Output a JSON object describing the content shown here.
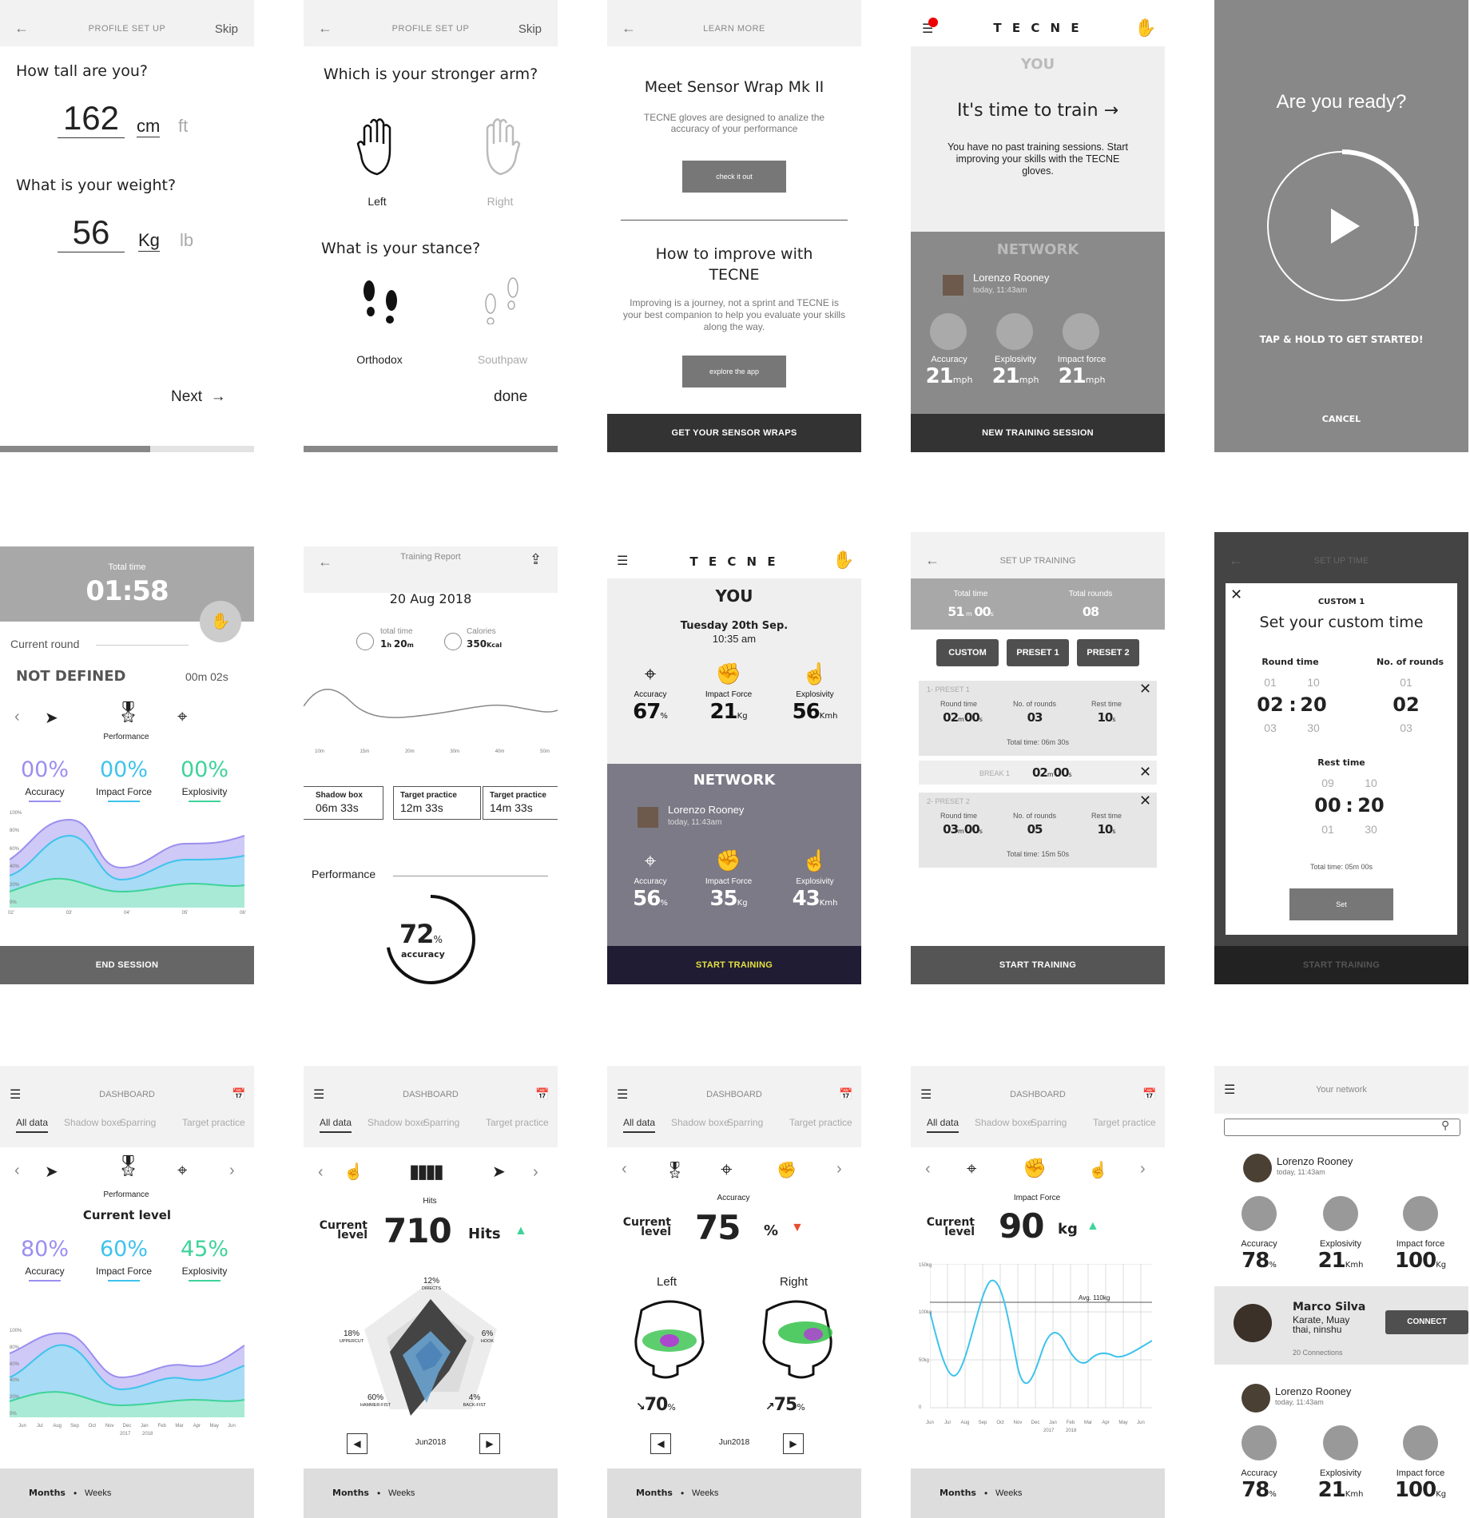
{
  "s1": {
    "header": "PROFILE SET UP",
    "skip": "Skip",
    "q1": "How tall are you?",
    "height": "162",
    "unit_cm": "cm",
    "unit_ft": "ft",
    "q2": "What is your weight?",
    "weight": "56",
    "unit_kg": "Kg",
    "unit_lb": "lb",
    "next": "Next",
    "progress": 0.59
  },
  "s2": {
    "header": "PROFILE SET UP",
    "skip": "Skip",
    "q1": "Which is your stronger arm?",
    "left": "Left",
    "right": "Right",
    "q2": "What is your stance?",
    "orthodox": "Orthodox",
    "southpaw": "Southpaw",
    "done": "done"
  },
  "s3": {
    "header": "LEARN MORE",
    "title1": "Meet Sensor Wrap Mk II",
    "text1": "TECNE gloves are designed to analize the accuracy of your performance",
    "btn1": "check it out",
    "title2": "How to improve with TECNE",
    "text2": "Improving is a journey, not a sprint and TECNE is your best companion to help you evaluate your skills along the way.",
    "btn2": "explore the app",
    "footer": "GET YOUR SENSOR WRAPS"
  },
  "s4": {
    "logo": "T E C N E",
    "you": "YOU",
    "cta": "It's time to train",
    "text": "You have no past training sessions. Start improving your skills with the TECNE gloves.",
    "network": "NETWORK",
    "user": "Lorenzo Rooney",
    "time": "today, 11:43am",
    "stats": [
      {
        "label": "Accuracy",
        "value": "21",
        "unit": "mph"
      },
      {
        "label": "Explosivity",
        "value": "21",
        "unit": "mph"
      },
      {
        "label": "Impact force",
        "value": "21",
        "unit": "mph"
      }
    ],
    "footer": "NEW TRAINING SESSION"
  },
  "s5": {
    "title": "Are you ready?",
    "hint": "TAP & HOLD TO  GET STARTED!",
    "cancel": "CANCEL"
  },
  "s6": {
    "total_label": "Total time",
    "total": "01:58",
    "round_label": "Current round",
    "state": "NOT DEFINED",
    "round_time": "00m 02s",
    "perf": "Performance",
    "stats": [
      {
        "label": "Accuracy",
        "value": "00%",
        "color": "#9b8ef0"
      },
      {
        "label": "Impact Force",
        "value": "00%",
        "color": "#3ec3ec"
      },
      {
        "label": "Explosivity",
        "value": "00%",
        "color": "#3ed39a"
      }
    ],
    "y_ticks": [
      "100%",
      "80%",
      "60%",
      "40%",
      "20%",
      "0%"
    ],
    "x_ticks": [
      "02'",
      "03'",
      "04'",
      "05'",
      "06'"
    ],
    "footer": "END SESSION"
  },
  "s7": {
    "header": "Training Report",
    "date": "20 Aug 2018",
    "tt_label": "total time",
    "tt_h": "1",
    "tt_m": "20",
    "cal_label": "Calories",
    "cal": "350",
    "cal_unit": "Kcal",
    "x_ticks": [
      "10m",
      "15m",
      "20m",
      "30m",
      "40m",
      "50m"
    ],
    "cards": [
      {
        "title": "Shadow box",
        "value": "06m 33s"
      },
      {
        "title": "Target practice",
        "value": "12m 33s"
      },
      {
        "title": "Target practice",
        "value": "14m 33s"
      }
    ],
    "perf": "Performance",
    "pct": "72",
    "pct_label": "accuracy"
  },
  "s8": {
    "logo": "T E C N E",
    "you": "YOU",
    "date": "Tuesday 20th Sep.",
    "time": "10:35 am",
    "you_stats": [
      {
        "label": "Accuracy",
        "value": "67",
        "unit": "%"
      },
      {
        "label": "Impact Force",
        "value": "21",
        "unit": "Kg"
      },
      {
        "label": "Explosivity",
        "value": "56",
        "unit": "Kmh"
      }
    ],
    "network": "NETWORK",
    "user": "Lorenzo Rooney",
    "utime": "today, 11:43am",
    "net_stats": [
      {
        "label": "Accuracy",
        "value": "56",
        "unit": "%"
      },
      {
        "label": "Impact Force",
        "value": "35",
        "unit": "Kg"
      },
      {
        "label": "Explosivity",
        "value": "43",
        "unit": "Kmh"
      }
    ],
    "footer": "START TRAINING"
  },
  "s9": {
    "header": "SET UP TRAINING",
    "tt_label": "Total time",
    "tt_m": "51",
    "tt_s": "00",
    "tr_label": "Total rounds",
    "tr": "08",
    "presets": [
      "CUSTOM",
      "PRESET 1",
      "PRESET 2"
    ],
    "p1": {
      "tag": "1- PRESET 1",
      "rt_label": "Round time",
      "rt_m": "02",
      "rt_s": "00",
      "nr_label": "No. of rounds",
      "nr": "03",
      "rest_label": "Rest time",
      "rest": "10",
      "total": "Total time: 06m 30s"
    },
    "brk": {
      "tag": "BREAK 1",
      "m": "02",
      "s": "00"
    },
    "p2": {
      "tag": "2- PRESET 2",
      "rt_label": "Round time",
      "rt_m": "03",
      "rt_s": "00",
      "nr_label": "No. of rounds",
      "nr": "05",
      "rest_label": "Rest time",
      "rest": "10",
      "total": "Total time: 15m 50s"
    },
    "footer": "START TRAINING"
  },
  "s10": {
    "header": "SET UP TIME",
    "tag": "CUSTOM 1",
    "title": "Set your custom time",
    "rt_label": "Round time",
    "nr_label": "No. of rounds",
    "rt_prev": [
      "01",
      "10"
    ],
    "rt": [
      "02",
      "20"
    ],
    "rt_next": [
      "03",
      "30"
    ],
    "nr_prev": "01",
    "nr": "02",
    "nr_next": "03",
    "rest_label": "Rest time",
    "rest_prev": [
      "09",
      "10"
    ],
    "rest": [
      "00",
      "20"
    ],
    "rest_next": [
      "01",
      "30"
    ],
    "total": "Total time: 05m 00s",
    "set": "Set",
    "footer": "START TRAINING"
  },
  "dash_tabs": [
    "All data",
    "Shadow boxe",
    "Sparring",
    "Target practice"
  ],
  "s11": {
    "header": "DASHBOARD",
    "perf": "Performance",
    "level": "Current level",
    "stats": [
      {
        "label": "Accuracy",
        "value": "80%",
        "color": "#9b8ef0"
      },
      {
        "label": "Impact Force",
        "value": "60%",
        "color": "#3ec3ec"
      },
      {
        "label": "Explosivity",
        "value": "45%",
        "color": "#3ed39a"
      }
    ],
    "y_ticks": [
      "100%",
      "80%",
      "60%",
      "40%",
      "20%",
      "0%"
    ],
    "x_ticks": [
      "Jun",
      "Jul",
      "Aug",
      "Sep",
      "Oct",
      "Nov",
      "Dec",
      "Jan",
      "Feb",
      "Mar",
      "Apr",
      "May",
      "Jun"
    ],
    "years": [
      "2017",
      "2018"
    ],
    "months": "Months",
    "weeks": "Weeks"
  },
  "s12": {
    "header": "DASHBOARD",
    "icon_label": "Hits",
    "level1": "Current",
    "level2": "level",
    "value": "710",
    "unit": "Hits",
    "radar": [
      {
        "pct": "12%",
        "label": "DIRECTS"
      },
      {
        "pct": "6%",
        "label": "HOOK"
      },
      {
        "pct": "4%",
        "label": "BACK-FIST"
      },
      {
        "pct": "60%",
        "label": "HAMMER-FIST"
      },
      {
        "pct": "18%",
        "label": "UPPERCUT"
      }
    ],
    "period": "Jun2018",
    "months": "Months",
    "weeks": "Weeks"
  },
  "s13": {
    "header": "DASHBOARD",
    "icon_label": "Accuracy",
    "level1": "Current",
    "level2": "level",
    "value": "75",
    "unit": "%",
    "left": "Left",
    "right": "Right",
    "left_val": "70",
    "right_val": "75",
    "period": "Jun2018",
    "months": "Months",
    "weeks": "Weeks"
  },
  "s14": {
    "header": "DASHBOARD",
    "icon_label": "Impact Force",
    "level1": "Current",
    "level2": "level",
    "value": "90",
    "unit": "kg",
    "avg": "Avg. 110kg",
    "y_ticks": [
      "150kg",
      "100kg",
      "50kg",
      "0"
    ],
    "x_ticks": [
      "Jun",
      "Jul",
      "Aug",
      "Sep",
      "Oct",
      "Nov",
      "Dec",
      "Jan",
      "Feb",
      "Mar",
      "Apr",
      "May",
      "Jun"
    ],
    "years": [
      "2017",
      "2018"
    ],
    "months": "Months",
    "weeks": "Weeks"
  },
  "s15": {
    "header": "Your network",
    "search_placeholder": "",
    "p1": {
      "name": "Lorenzo Rooney",
      "time": "today, 11:43am"
    },
    "stats": [
      {
        "label": "Accuracy",
        "value": "78",
        "unit": "%"
      },
      {
        "label": "Explosivity",
        "value": "21",
        "unit": "Kmh"
      },
      {
        "label": "Impact force",
        "value": "100",
        "unit": "Kg"
      }
    ],
    "p2": {
      "name": "Marco Silva",
      "bio": "Karate, Muay thai, ninshu",
      "conn": "20 Connections",
      "btn": "CONNECT"
    },
    "p3": {
      "name": "Lorenzo Rooney",
      "time": "today, 11:43am"
    },
    "stats2": [
      {
        "label": "Accuracy",
        "value": "78",
        "unit": "%"
      },
      {
        "label": "Explosivity",
        "value": "21",
        "unit": "Kmh"
      },
      {
        "label": "Impact force",
        "value": "100",
        "unit": "Kg"
      }
    ]
  },
  "chart_data": [
    {
      "type": "area",
      "x": [
        "02'",
        "03'",
        "04'",
        "05'",
        "06'"
      ],
      "series": [],
      "ylim": [
        0,
        100
      ]
    },
    {
      "type": "bar",
      "categories": [
        "Accuracy",
        "Impact Force",
        "Explosivity"
      ],
      "values": [
        80,
        60,
        45
      ]
    },
    {
      "type": "line",
      "x": [
        "Jun",
        "Jul",
        "Aug",
        "Sep",
        "Oct",
        "Nov",
        "Dec",
        "Jan",
        "Feb",
        "Mar",
        "Apr",
        "May",
        "Jun"
      ],
      "ylim": [
        0,
        150
      ]
    }
  ]
}
